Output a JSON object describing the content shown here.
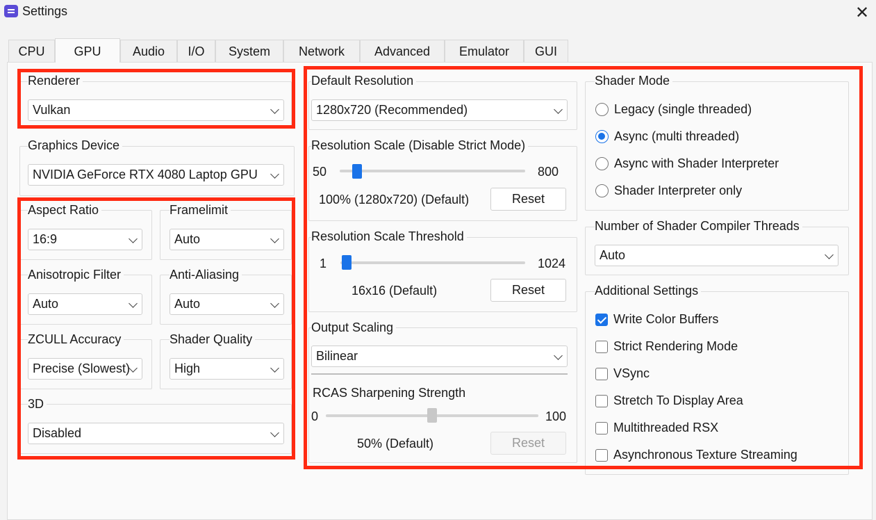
{
  "window": {
    "title": "Settings",
    "close": "✕"
  },
  "tabs": [
    {
      "label": "CPU"
    },
    {
      "label": "GPU"
    },
    {
      "label": "Audio"
    },
    {
      "label": "I/O"
    },
    {
      "label": "System"
    },
    {
      "label": "Network"
    },
    {
      "label": "Advanced"
    },
    {
      "label": "Emulator"
    },
    {
      "label": "GUI"
    }
  ],
  "active_tab": "GPU",
  "renderer": {
    "label": "Renderer",
    "value": "Vulkan"
  },
  "graphics_device": {
    "label": "Graphics Device",
    "value": "NVIDIA GeForce RTX 4080 Laptop GPU"
  },
  "aspect_ratio": {
    "label": "Aspect Ratio",
    "value": "16:9"
  },
  "framelimit": {
    "label": "Framelimit",
    "value": "Auto"
  },
  "anisotropic": {
    "label": "Anisotropic Filter",
    "value": "Auto"
  },
  "antialiasing": {
    "label": "Anti-Aliasing",
    "value": "Auto"
  },
  "zcull": {
    "label": "ZCULL Accuracy",
    "value": "Precise (Slowest)"
  },
  "shader_quality": {
    "label": "Shader Quality",
    "value": "High"
  },
  "three_d": {
    "label": "3D",
    "value": "Disabled"
  },
  "default_resolution": {
    "label": "Default Resolution",
    "value": "1280x720 (Recommended)"
  },
  "resolution_scale": {
    "label": "Resolution Scale (Disable Strict Mode)",
    "min": "50",
    "max": "800",
    "value_text": "100% (1280x720) (Default)",
    "reset": "Reset",
    "fraction": 0.033
  },
  "resolution_threshold": {
    "label": "Resolution Scale Threshold",
    "min": "1",
    "max": "1024",
    "value_text": "16x16 (Default)",
    "reset": "Reset",
    "fraction": 0.015
  },
  "output_scaling": {
    "label": "Output Scaling",
    "value": "Bilinear"
  },
  "rcas": {
    "label": "RCAS Sharpening Strength",
    "min": "0",
    "max": "100",
    "value_text": "50% (Default)",
    "reset": "Reset",
    "fraction": 0.5
  },
  "shader_mode": {
    "label": "Shader Mode",
    "options": [
      {
        "label": "Legacy (single threaded)",
        "selected": false
      },
      {
        "label": "Async (multi threaded)",
        "selected": true
      },
      {
        "label": "Async with Shader Interpreter",
        "selected": false
      },
      {
        "label": "Shader Interpreter only",
        "selected": false
      }
    ]
  },
  "compiler_threads": {
    "label": "Number of Shader Compiler Threads",
    "value": "Auto"
  },
  "additional": {
    "label": "Additional Settings",
    "options": [
      {
        "label": "Write Color Buffers",
        "checked": true
      },
      {
        "label": "Strict Rendering Mode",
        "checked": false
      },
      {
        "label": "VSync",
        "checked": false
      },
      {
        "label": "Stretch To Display Area",
        "checked": false
      },
      {
        "label": "Multithreaded RSX",
        "checked": false
      },
      {
        "label": "Asynchronous Texture Streaming",
        "checked": false
      }
    ]
  },
  "colors": {
    "highlight": "#ff2a12",
    "accent": "#1a73e8"
  }
}
